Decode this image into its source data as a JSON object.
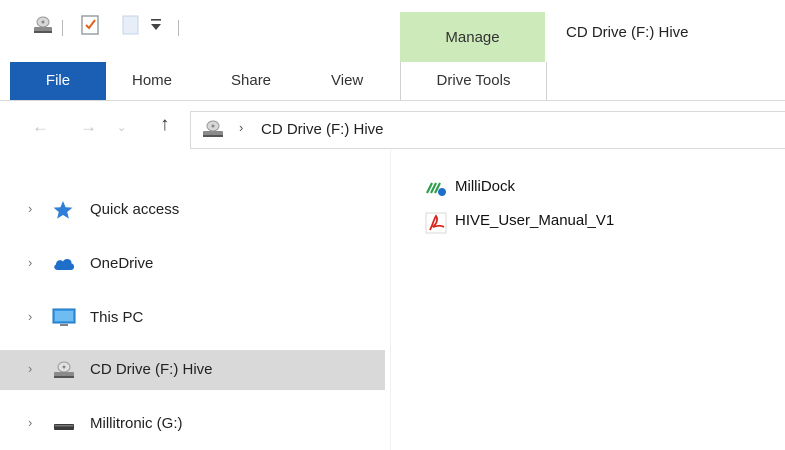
{
  "window": {
    "title": "CD Drive (F:) Hive"
  },
  "ribbon": {
    "contextual_group": "Manage",
    "tabs": {
      "file": "File",
      "home": "Home",
      "share": "Share",
      "view": "View",
      "drive_tools": "Drive Tools"
    }
  },
  "address_bar": {
    "path": "CD Drive (F:) Hive",
    "icon": "cd-drive-icon"
  },
  "navigation_pane": {
    "items": [
      {
        "label": "Quick access",
        "icon": "star-icon",
        "selected": false
      },
      {
        "label": "OneDrive",
        "icon": "cloud-icon",
        "selected": false
      },
      {
        "label": "This PC",
        "icon": "monitor-icon",
        "selected": false
      },
      {
        "label": "CD Drive (F:) Hive",
        "icon": "cd-drive-icon",
        "selected": true
      },
      {
        "label": "Millitronic (G:)",
        "icon": "usb-drive-icon",
        "selected": false
      }
    ]
  },
  "content": {
    "files": [
      {
        "name": "MilliDock",
        "icon": "millidock-app-icon"
      },
      {
        "name": "HIVE_User_Manual_V1",
        "icon": "pdf-icon"
      }
    ]
  },
  "colors": {
    "file_tab": "#1a5fb4",
    "manage_tab": "#cdeabb",
    "selected_item": "#d9d9d9"
  }
}
